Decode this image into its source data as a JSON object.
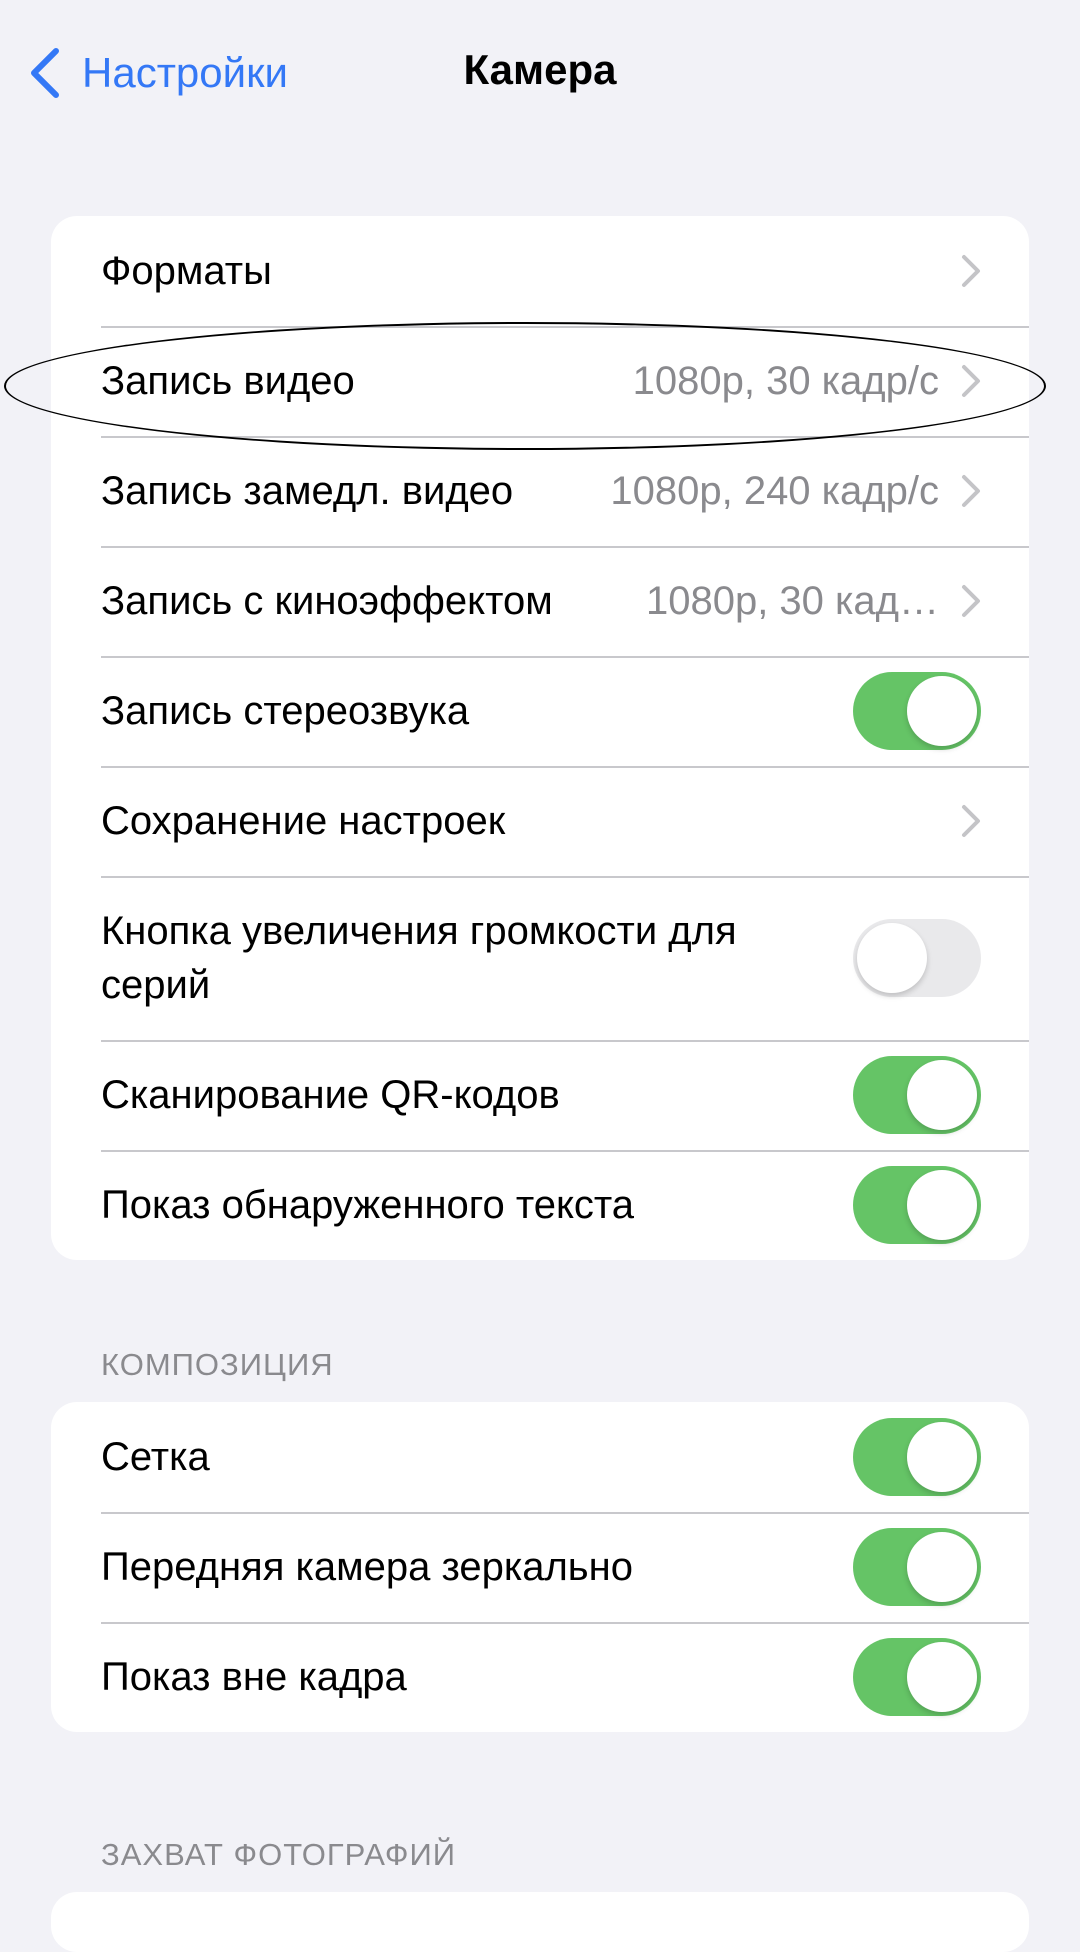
{
  "navbar": {
    "back_label": "Настройки",
    "title": "Камера"
  },
  "main_group": [
    {
      "label": "Форматы",
      "value": "",
      "control": "chevron"
    },
    {
      "label": "Запись видео",
      "value": "1080p, 30 кадр/с",
      "control": "chevron"
    },
    {
      "label": "Запись замедл. видео",
      "value": "1080p, 240 кадр/с",
      "control": "chevron"
    },
    {
      "label": "Запись с киноэффектом",
      "value": "1080p, 30 кад…",
      "control": "chevron"
    },
    {
      "label": "Запись стереозвука",
      "control": "toggle",
      "on": true
    },
    {
      "label": "Сохранение настроек",
      "value": "",
      "control": "chevron"
    },
    {
      "label": "Кнопка увеличения громкости для серий",
      "control": "toggle",
      "on": false
    },
    {
      "label": "Сканирование QR-кодов",
      "control": "toggle",
      "on": true
    },
    {
      "label": "Показ обнаруженного текста",
      "control": "toggle",
      "on": true
    }
  ],
  "composition": {
    "header": "КОМПОЗИЦИЯ",
    "items": [
      {
        "label": "Сетка",
        "control": "toggle",
        "on": true
      },
      {
        "label": "Передняя камера зеркально",
        "control": "toggle",
        "on": true
      },
      {
        "label": "Показ вне кадра",
        "control": "toggle",
        "on": true
      }
    ]
  },
  "photo_capture": {
    "header": "ЗАХВАТ ФОТОГРАФИЙ"
  },
  "colors": {
    "accent": "#3478f6",
    "toggle_on": "#65c466",
    "toggle_off": "#e9e9eb",
    "background": "#f2f2f7",
    "secondary_text": "#8a8a8e"
  }
}
